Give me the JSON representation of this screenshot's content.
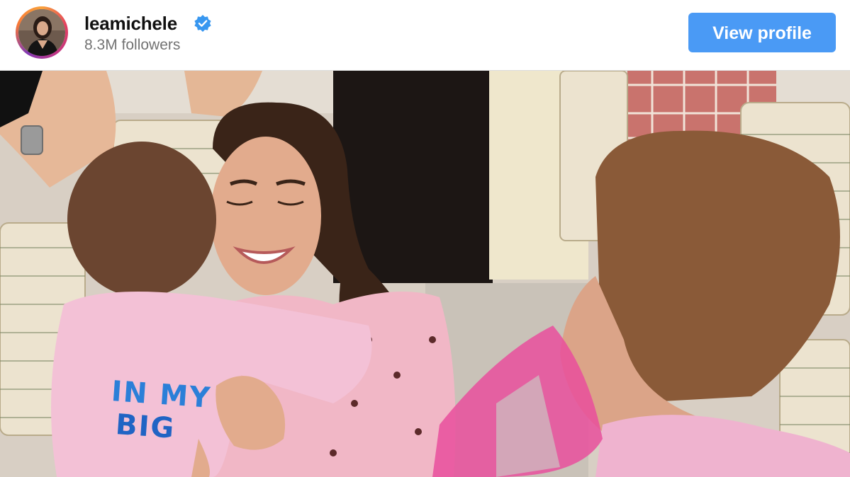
{
  "profile": {
    "username": "leamichele",
    "verified": true,
    "followers": "8.3M followers",
    "view_profile_label": "View profile"
  },
  "post": {
    "shirt_text_line1": "IN MY",
    "shirt_text_line2": "BIG"
  },
  "colors": {
    "button": "#4a9af5",
    "verified_badge": "#3897f0",
    "username": "#111111",
    "followers": "#737373"
  },
  "icons": {
    "verified": "verified-badge-icon"
  }
}
